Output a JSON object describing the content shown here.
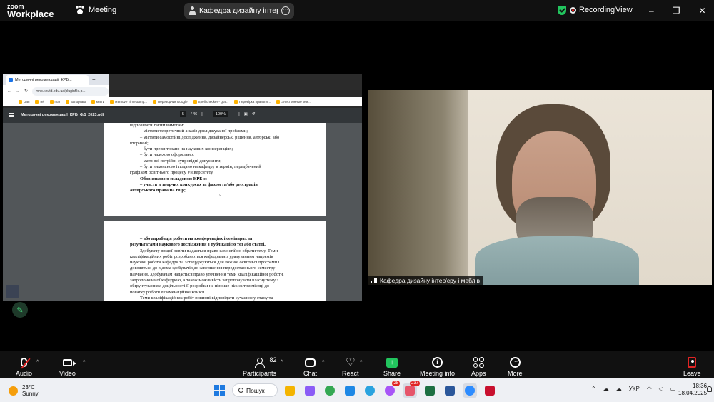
{
  "zoom": {
    "logo_top": "zoom",
    "logo_bottom": "Workplace",
    "meeting_label": "Meeting",
    "share_title": "Кафедра дизайну інтер'єру і ме",
    "recording_label": "Recording",
    "view_label": "View",
    "win_minimize": "–",
    "win_restore": "❐",
    "win_close": "✕"
  },
  "browser": {
    "tab_title": "Методичні рекомендації_КРБ...",
    "new_tab": "+",
    "url": "mnp.knutd.edu.ua/pluginfile.p...",
    "nav": [
      "←",
      "→",
      "↻"
    ],
    "bookmarks": [
      "Dan",
      "rel",
      "mar",
      "запорташ",
      "книги",
      "Remove Timestamp...",
      "Переводчик Google",
      "Spell checker - gra...",
      "Перевірка правопл...",
      "Электронные книг..."
    ]
  },
  "pdf": {
    "title": "Методичні рекомендації_КРБ_ФД_2023.pdf",
    "page_current": "5",
    "page_total": "/ 46",
    "zoom_minus": "−",
    "zoom_value": "100%",
    "zoom_plus": "+",
    "page1_lines": [
      {
        "t": "відповідати таким вимогам:",
        "cls": ""
      },
      {
        "t": "–       містити теоретичний аналіз досліджуваної проблеми;",
        "cls": "ind"
      },
      {
        "t": "–       містити самостійні дослідження, дизайнерські рішення, авторські або",
        "cls": "ind"
      },
      {
        "t": "вторинні;",
        "cls": ""
      },
      {
        "t": "–       бути презентовано на наукових конференціях;",
        "cls": "ind"
      },
      {
        "t": "–       бути належно оформлено;",
        "cls": "ind"
      },
      {
        "t": "–       мати всі потрібні супровідні документи;",
        "cls": "ind"
      },
      {
        "t": "–       бути виконаною і подано на кафедру в термін, передбачений",
        "cls": "ind"
      },
      {
        "t": "графіком освітнього процесу Університету.",
        "cls": ""
      },
      {
        "t": "Обов'язковою складовою КРБ є:",
        "cls": "ind b"
      },
      {
        "t": "–   участь в творчих конкурсах за фахом та/або реєстрація",
        "cls": "ind b"
      },
      {
        "t": "авторського права на твір;",
        "cls": "b"
      }
    ],
    "page1_number": "5",
    "page2_lines": [
      {
        "t": "–   або апробація роботи на конференціях і семінарах за",
        "cls": "ind b"
      },
      {
        "t": "результатами наукового дослідження з публікацією тез або статті.",
        "cls": "b"
      },
      {
        "t": "Здобувачу вищої освіти надається право самостійно обрати тему. Теми",
        "cls": "ind"
      },
      {
        "t": "кваліфікаційних робіт розробляються кафедрами з урахуванням напрямів",
        "cls": ""
      },
      {
        "t": "наукової роботи кафедри та затверджуються для кожної освітньої програми і",
        "cls": ""
      },
      {
        "t": "доводяться до відома здобувачів до завершення передостаннього семестру",
        "cls": ""
      },
      {
        "t": "навчання. Здобувачам надається право уточнення теми кваліфікаційної роботи,",
        "cls": ""
      },
      {
        "t": "запропонованої кафедрою, а також можливість запропонувати власну тему з",
        "cls": ""
      },
      {
        "t": "обґрунтуванням доцільності її розробки не пізніше ніж за три місяці до",
        "cls": ""
      },
      {
        "t": "початку роботи екзаменаційної комісії.",
        "cls": ""
      },
      {
        "t": "Теми кваліфікаційних робіт повинні відповідати сучасному стану та",
        "cls": "ind"
      }
    ]
  },
  "video": {
    "participant_label": "Кафедра дизайну інтер'єру і меблів"
  },
  "toolbar": {
    "audio": "Audio",
    "video": "Video",
    "participants": "Participants",
    "participant_count": "82",
    "chat": "Chat",
    "react": "React",
    "share": "Share",
    "meeting_info": "Meeting info",
    "apps": "Apps",
    "more": "More",
    "leave": "Leave",
    "caret": "^"
  },
  "taskbar": {
    "temperature": "23°C",
    "weather": "Sunny",
    "search_label": "Пошук",
    "telegram_badge": "28",
    "app_badge": "237",
    "language": "УКР",
    "time": "18:36",
    "date": "18.04.2025",
    "colors": {
      "files": "#f4b400",
      "copilot": "#8b5cf6",
      "chrome": "#34a853",
      "store": "#1e88e5",
      "telegram": "#2aa3df",
      "messenger": "#a855f7",
      "active_app": "#e6556a",
      "excel": "#1d6f42",
      "word": "#2b579a",
      "zoom": "#2d8cff",
      "acrobat": "#c8102e"
    }
  }
}
